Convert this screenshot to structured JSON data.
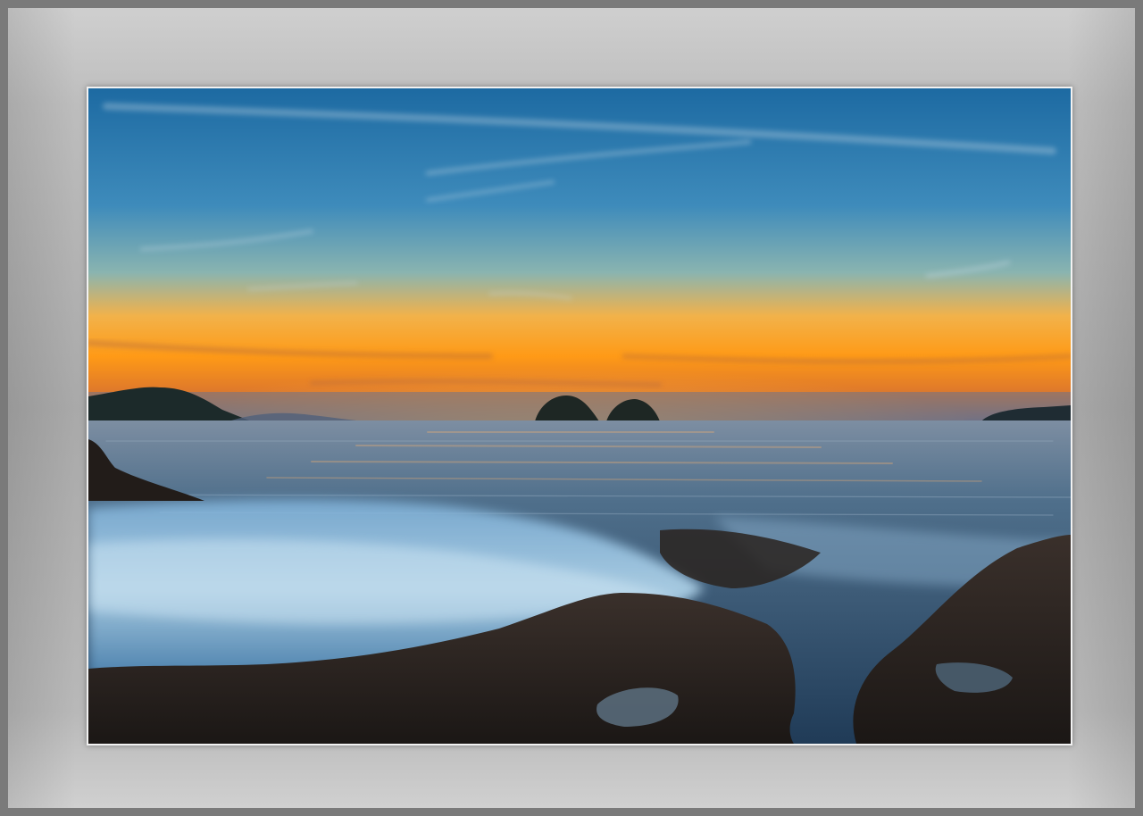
{
  "scene": {
    "subject": "seascape-sunset",
    "colors": {
      "sky_top": "#1f6fa6",
      "sky_mid": "#4f9ac4",
      "horizon_glow": "#ff9a1a",
      "horizon_orange": "#f07a10",
      "sea": "#4a6c86",
      "wave_foam": "#9ec7e6",
      "rock": "#2a2522",
      "frame": "#a9a9a9"
    }
  }
}
